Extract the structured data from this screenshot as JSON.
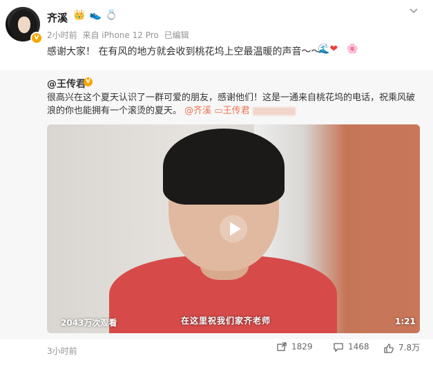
{
  "post": {
    "username": "齐溪",
    "badges": [
      "crown-heart-icon",
      "shoe-icon",
      "ring-icon"
    ],
    "meta": {
      "time": "2小时前",
      "source": "来自 iPhone 12 Pro",
      "edited": "已编辑"
    },
    "text": "感谢大家！ 在有风的地方就会收到桃花坞上空最温暖的声音～～",
    "emojis": [
      "wave-emoji",
      "heart-emoji",
      "flower-emoji"
    ]
  },
  "repost": {
    "author": "@王传君",
    "text_before": "很高兴在这个夏天认识了一群可爱的朋友，感谢他们！这是一通来自桃花坞的电话，祝乘风破浪的你也能拥有一个滚烫的夏天。",
    "mention1": "@齐溪",
    "mention2": "王传君",
    "video": {
      "views": "2043万次观看",
      "subtitle": "在这里祝我们家齐老师",
      "duration": "1:21"
    },
    "time": "3小时前",
    "counts": {
      "forward": "1829",
      "comment": "1468",
      "like": "7.8万"
    }
  },
  "colors": {
    "accent": "#eb7350",
    "badge": "#f7a600",
    "repost_bg": "#f7f7f7"
  }
}
